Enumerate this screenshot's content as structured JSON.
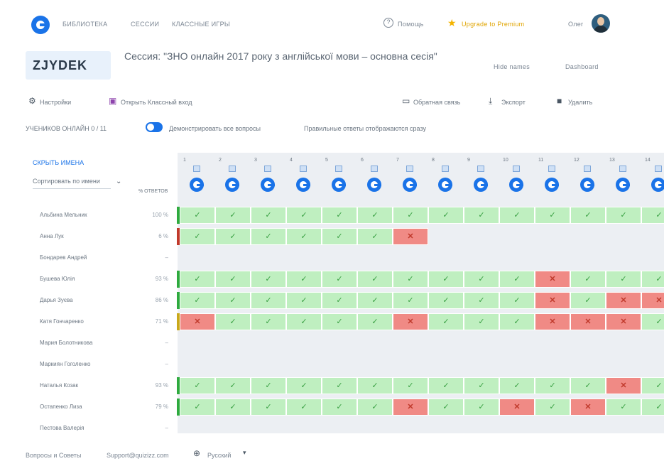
{
  "nav": {
    "links": [
      "БИБЛИОТЕКА",
      "СЕССИИ",
      "КЛАССНЫЕ ИГРЫ"
    ],
    "help": "Помощь",
    "upgrade": "Upgrade to Premium",
    "user": "Олег"
  },
  "header": {
    "code": "ZJYDEK",
    "title": "Сессия: \"ЗНО онлайн 2017 року з англійської мови – основна сесія\"",
    "hide_names": "Hide names",
    "dashboard": "Dashboard"
  },
  "toolbar": {
    "settings": "Настройки",
    "open_class": "Открыть Классный вход",
    "feedback": "Обратная связь",
    "export": "Экспорт",
    "delete": "Удалить"
  },
  "options": {
    "students": "УЧЕНИКОВ ОНЛАЙН 0 / 11",
    "show_answers": "Демонстрировать все вопросы",
    "correct_answers": "Правильные ответы отображаются сразу"
  },
  "list_controls": {
    "hide_names": "СКРЫТЬ ИМЕНА",
    "sort": "Сортировать по имени",
    "score_header": "% ОТВЕТОВ"
  },
  "columns": [
    "1",
    "2",
    "3",
    "4",
    "5",
    "6",
    "7",
    "8",
    "9",
    "10",
    "11",
    "12",
    "13",
    "14"
  ],
  "rows": [
    {
      "name": "Альбина Мельник",
      "score": "100 %",
      "bar": "#2eaa3e",
      "cells": "oooooooooooooo"
    },
    {
      "name": "Анна Лук",
      "score": "6 %",
      "bar": "#c0392b",
      "cells": "ooooooxeeeeeee"
    },
    {
      "name": "Бондарев Андрей",
      "score": "–",
      "bar": "",
      "cells": "eeeeeeeeeeeeee"
    },
    {
      "name": "Бушева Юлія",
      "score": "93 %",
      "bar": "#2eaa3e",
      "cells": "ooooooooooxooo"
    },
    {
      "name": "Дарья Зуєва",
      "score": "86 %",
      "bar": "#2eaa3e",
      "cells": "ooooooooooxoxx"
    },
    {
      "name": "Катя Гончаренко",
      "score": "71 %",
      "bar": "#c9a81a",
      "cells": "xoooooxoooxxxo"
    },
    {
      "name": "Мария Болотникова",
      "score": "–",
      "bar": "",
      "cells": "eeeeeeeeeeeeee"
    },
    {
      "name": "Маркиян Гоголенко",
      "score": "–",
      "bar": "",
      "cells": "eeeeeeeeeeeeee"
    },
    {
      "name": "Наталья Козак",
      "score": "93 %",
      "bar": "#2eaa3e",
      "cells": "ooooooooooooxo"
    },
    {
      "name": "Остапенко Лиза",
      "score": "79 %",
      "bar": "#2eaa3e",
      "cells": "ooooooxooxoxoo"
    },
    {
      "name": "Пестова Валерія",
      "score": "–",
      "bar": "",
      "cells": "eeeeeeeeeeeeee"
    }
  ],
  "footer": {
    "terms": "Вопросы и Советы",
    "support": "Support@quizizz.com",
    "language": "Русский"
  }
}
